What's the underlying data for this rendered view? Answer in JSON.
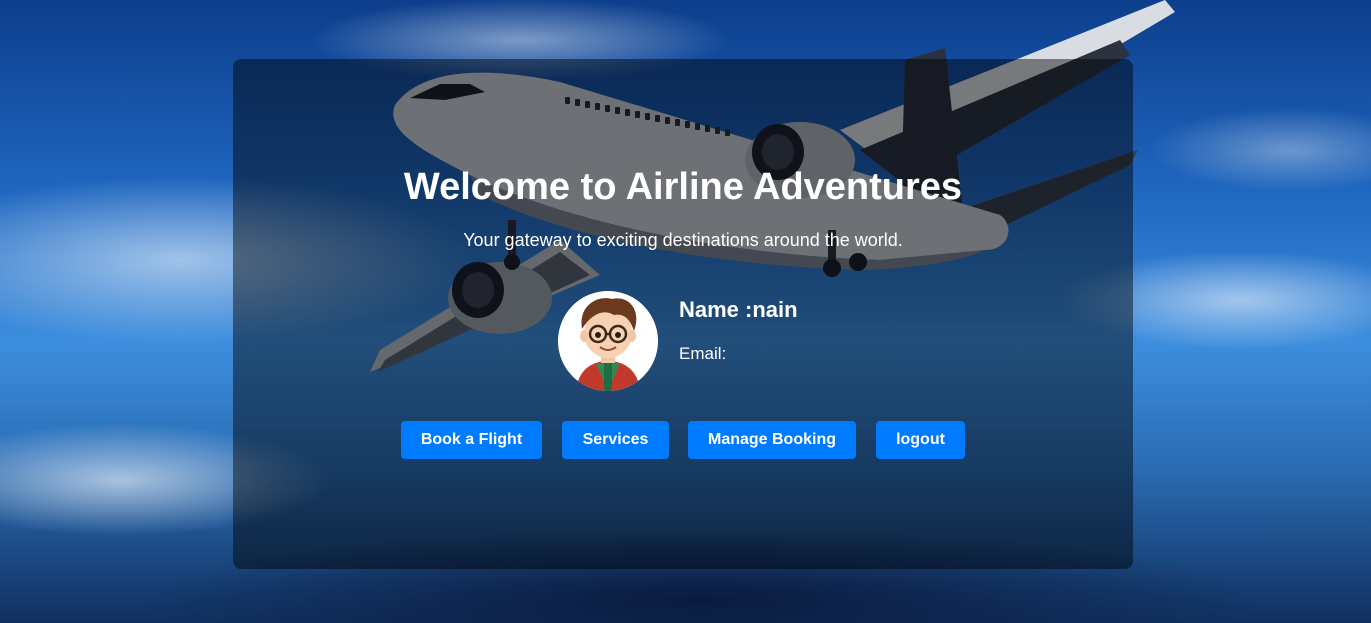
{
  "hero": {
    "title": "Welcome to Airline Adventures",
    "subtitle": "Your gateway to exciting destinations around the world."
  },
  "profile": {
    "name": "Name :nain",
    "email_label": "Email:",
    "avatar_icon": "cartoon-boy-avatar"
  },
  "actions": {
    "book": "Book a Flight",
    "services": "Services",
    "manage": "Manage Booking",
    "logout": "logout"
  },
  "colors": {
    "button": "#007bff",
    "card_overlay": "rgba(0,0,0,0.45)",
    "text": "#ffffff"
  }
}
